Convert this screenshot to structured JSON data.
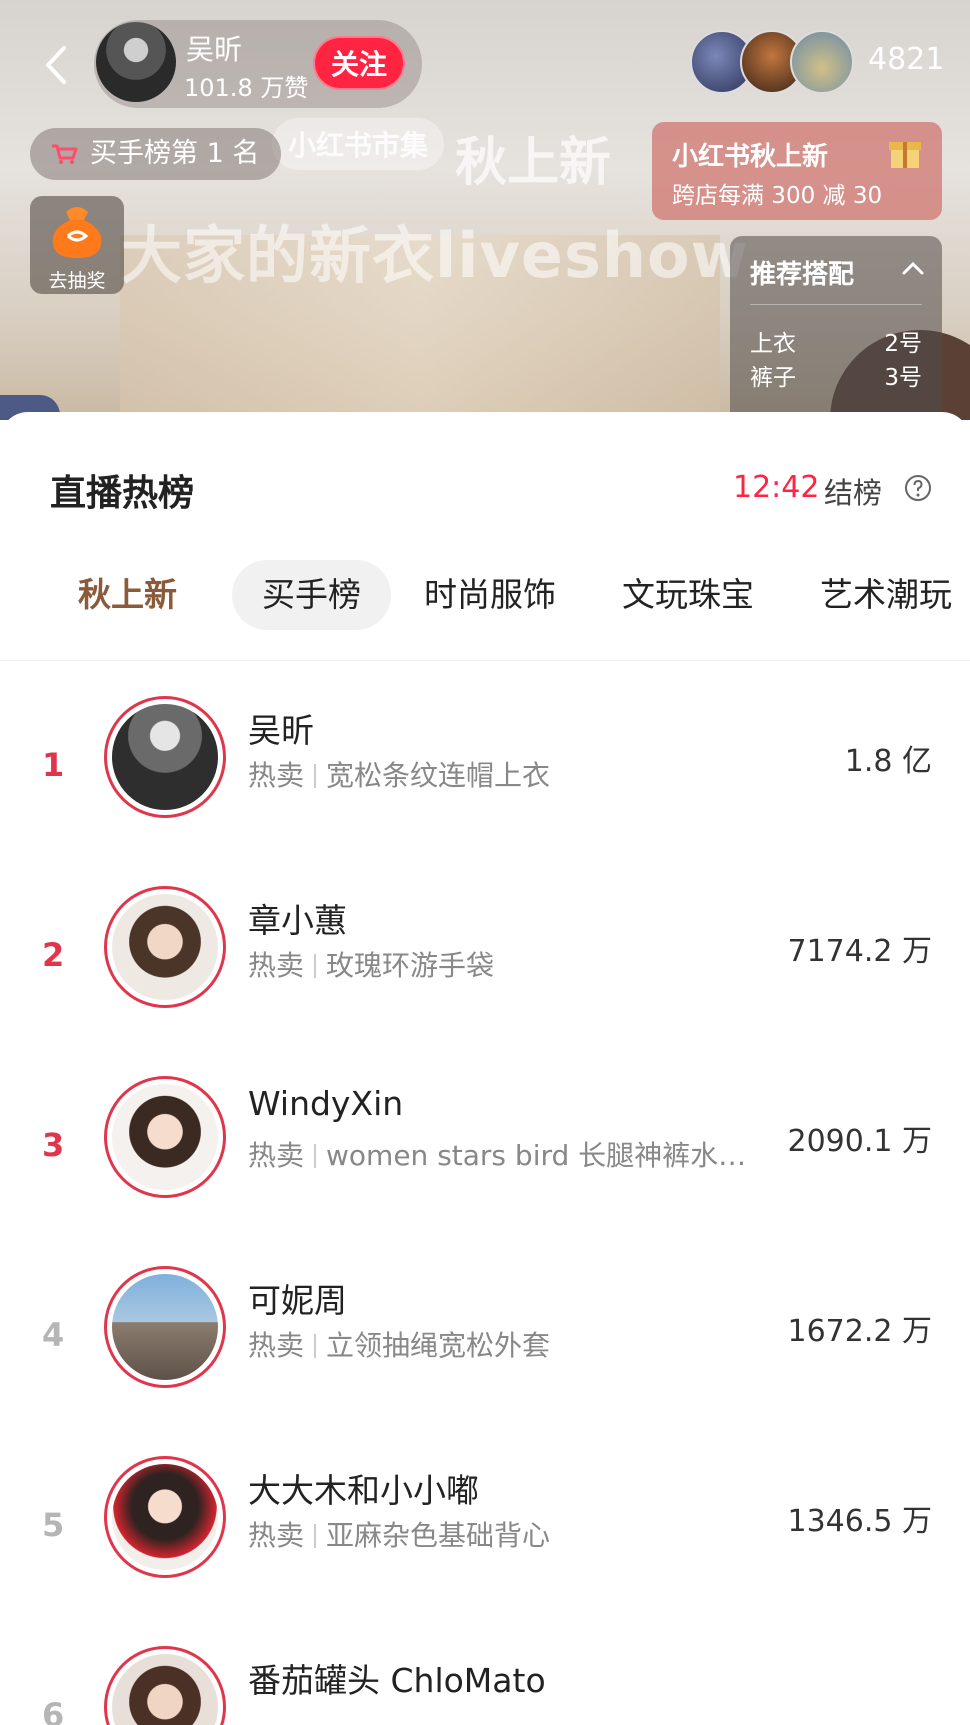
{
  "header": {
    "host_name": "吴昕",
    "host_likes": "101.8 万赞",
    "follow_label": "关注",
    "viewer_count": "4821",
    "rank_badge": "买手榜第 1 名",
    "lottery_label": "去抽奖",
    "banner_market": "小红书市集",
    "banner_season": "秋上新",
    "banner_show": "大家的新衣liveshow"
  },
  "promo": {
    "title": "小红书秋上新",
    "subtitle": "跨店每满 300 减 30"
  },
  "recommend": {
    "title": "推荐搭配",
    "items": [
      {
        "label": "上衣",
        "value": "2号"
      },
      {
        "label": "裤子",
        "value": "3号"
      }
    ]
  },
  "sheet": {
    "title": "直播热榜",
    "countdown": "12:42",
    "end_label": "结榜"
  },
  "tabs": [
    "秋上新",
    "买手榜",
    "时尚服饰",
    "文玩珠宝",
    "艺术潮玩"
  ],
  "ranking": [
    {
      "rank": "1",
      "name": "吴昕",
      "hot_label": "热卖",
      "hot_item": "宽松条纹连帽上衣",
      "amount": "1.8 亿"
    },
    {
      "rank": "2",
      "name": "章小蕙",
      "hot_label": "热卖",
      "hot_item": "玫瑰环游手袋",
      "amount": "7174.2 万"
    },
    {
      "rank": "3",
      "name": "WindyXin",
      "hot_label": "热卖",
      "hot_item": "women stars bird 长腿神裤水…",
      "amount": "2090.1 万"
    },
    {
      "rank": "4",
      "name": "可妮周",
      "hot_label": "热卖",
      "hot_item": "立领抽绳宽松外套",
      "amount": "1672.2 万"
    },
    {
      "rank": "5",
      "name": "大大木和小小嘟",
      "hot_label": "热卖",
      "hot_item": "亚麻杂色基础背心",
      "amount": "1346.5 万"
    },
    {
      "rank": "6",
      "name": "番茄罐头 ChloMato",
      "hot_label": "",
      "hot_item": "",
      "amount": ""
    }
  ],
  "colors": {
    "accent": "#ff2442",
    "rank_top": "#e0364c",
    "rank_other": "#b5b5b5",
    "tab_active": "#8a5a3a"
  }
}
